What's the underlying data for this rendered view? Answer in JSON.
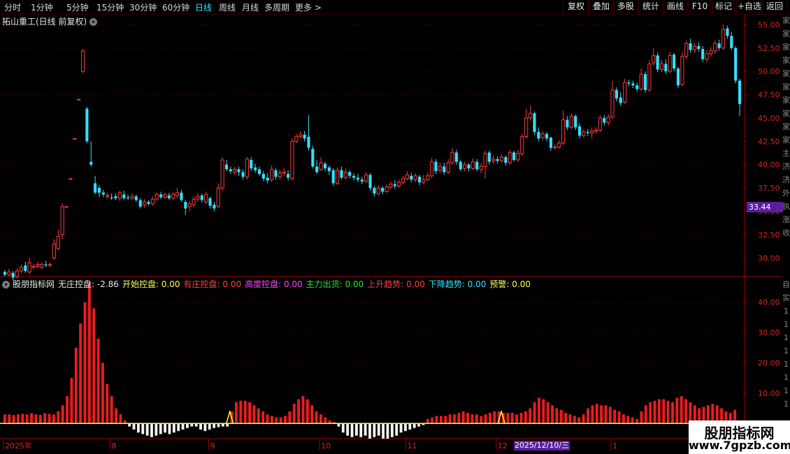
{
  "toolbar": {
    "periods": [
      "分时",
      "1分钟",
      "5分钟",
      "15分钟",
      "30分钟",
      "60分钟",
      "日线",
      "周线",
      "月线",
      "多周期",
      "更多 >"
    ],
    "active_period": "日线",
    "right_buttons": [
      "复权",
      "叠加",
      "多股",
      "统计",
      "画线",
      "F10",
      "标记",
      "+自选",
      "返回"
    ]
  },
  "stock_title": "拓山重工(日线 前复权)",
  "indicator": {
    "name": "股朋指标网",
    "legend": [
      {
        "label": "无庄控盘: -2.86",
        "color": "#e8e8e8"
      },
      {
        "label": "开始控盘: 0.00",
        "color": "#ffff55"
      },
      {
        "label": "有庄控盘: 0.00",
        "color": "#ff4040"
      },
      {
        "label": "高度控盘: 0.00",
        "color": "#ff44ff"
      },
      {
        "label": "主力出货: 0.00",
        "color": "#33dd33"
      },
      {
        "label": "上升趋势: 0.00",
        "color": "#ff4040"
      },
      {
        "label": "下降趋势: 0.00",
        "color": "#33e0ff"
      },
      {
        "label": "预警: 0.00",
        "color": "#ffff55"
      }
    ]
  },
  "price_axis": {
    "ticks": [
      "55.00",
      "52.50",
      "50.00",
      "47.50",
      "45.00",
      "42.50",
      "40.00",
      "37.50",
      "35.00",
      "32.50",
      "30.00"
    ],
    "current_price": "33.44"
  },
  "indicator_axis": {
    "ticks": [
      "40.00",
      "30.00",
      "20.00",
      "10.00"
    ]
  },
  "date_axis": {
    "labels": [
      "2025年",
      "8",
      "9",
      "10",
      "11",
      "12",
      "1"
    ],
    "cursor_date": "2025/12/10/三"
  },
  "side_strip": {
    "top": [
      "家",
      "家",
      "家",
      "家",
      "家",
      "家",
      "家",
      "家",
      "家",
      "家",
      "主",
      "济",
      "济",
      "外",
      "执",
      "涨",
      "收"
    ],
    "bottom": [
      "自",
      "实",
      "1",
      "1",
      "1",
      "1",
      "1",
      "1",
      "1",
      "1"
    ]
  },
  "watermark": {
    "title": "股朋指标网",
    "url": "www.7gpzb.com"
  },
  "colors": {
    "up": "#ff3b3b",
    "down": "#33e0ff",
    "grid": "#5a0000",
    "axis_text": "#e02020"
  },
  "chart_data": [
    {
      "type": "candlestick",
      "title": "拓山重工(日线 前复权)",
      "ylim": [
        28,
        56
      ],
      "candles": [
        [
          28.5,
          28.2,
          28.7,
          28.0
        ],
        [
          28.2,
          28.5,
          28.8,
          28.0
        ],
        [
          28.4,
          27.9,
          28.6,
          27.6
        ],
        [
          28.0,
          28.6,
          28.9,
          27.8
        ],
        [
          28.6,
          29.0,
          29.3,
          28.4
        ],
        [
          29.2,
          28.6,
          29.6,
          28.4
        ],
        [
          28.5,
          29.5,
          30.0,
          28.3
        ],
        [
          29.0,
          29.1,
          29.4,
          28.8
        ],
        [
          29.1,
          29.3,
          29.6,
          28.9
        ],
        [
          29.0,
          29.3,
          29.5,
          28.8
        ],
        [
          29.3,
          29.2,
          29.7,
          29.0
        ],
        [
          29.2,
          29.3,
          29.5,
          29.0
        ],
        [
          30.0,
          31.5,
          32.0,
          29.8
        ],
        [
          31.0,
          32.3,
          33.0,
          30.8
        ],
        [
          32.5,
          35.5,
          35.8,
          32.0
        ],
        [
          35.5,
          35.5,
          35.5,
          35.5
        ],
        [
          38.5,
          38.5,
          38.5,
          38.5
        ],
        [
          42.8,
          42.8,
          42.8,
          42.8
        ],
        [
          47.0,
          47.0,
          47.0,
          47.0
        ],
        [
          50.0,
          52.2,
          52.4,
          49.8
        ],
        [
          46.0,
          42.5,
          46.2,
          42.3
        ],
        [
          40.3,
          40.0,
          42.5,
          39.8
        ],
        [
          38.0,
          37.0,
          38.8,
          36.8
        ],
        [
          37.5,
          37.0,
          37.8,
          36.5
        ],
        [
          37.0,
          36.8,
          37.3,
          36.5
        ],
        [
          36.6,
          36.7,
          37.0,
          36.3
        ],
        [
          36.5,
          36.4,
          36.9,
          36.2
        ],
        [
          36.6,
          36.4,
          36.9,
          36.2
        ],
        [
          36.4,
          37.0,
          37.2,
          36.1
        ],
        [
          36.8,
          36.4,
          37.2,
          36.2
        ],
        [
          36.5,
          36.4,
          36.8,
          36.2
        ],
        [
          36.4,
          36.6,
          36.9,
          36.2
        ],
        [
          36.6,
          36.2,
          36.8,
          36.0
        ],
        [
          36.2,
          35.5,
          36.4,
          35.3
        ],
        [
          35.7,
          36.0,
          36.3,
          35.4
        ],
        [
          36.0,
          35.8,
          36.2,
          35.6
        ],
        [
          35.8,
          36.3,
          36.6,
          35.6
        ],
        [
          36.3,
          36.8,
          37.0,
          36.1
        ],
        [
          36.8,
          36.5,
          37.1,
          36.3
        ],
        [
          36.5,
          36.8,
          37.0,
          36.3
        ],
        [
          36.7,
          36.4,
          37.0,
          36.2
        ],
        [
          36.4,
          36.8,
          37.1,
          36.2
        ],
        [
          36.7,
          37.0,
          37.5,
          36.4
        ],
        [
          37.0,
          36.2,
          37.3,
          36.0
        ],
        [
          36.0,
          35.3,
          36.2,
          34.6
        ],
        [
          35.5,
          35.8,
          36.1,
          35.0
        ],
        [
          35.7,
          36.3,
          36.6,
          35.4
        ],
        [
          36.3,
          36.6,
          36.9,
          36.0
        ],
        [
          36.7,
          36.2,
          36.9,
          35.9
        ],
        [
          36.0,
          36.8,
          37.1,
          35.8
        ],
        [
          36.4,
          35.6,
          36.6,
          35.3
        ],
        [
          35.7,
          35.3,
          36.0,
          35.0
        ],
        [
          35.5,
          37.5,
          38.0,
          35.3
        ],
        [
          37.5,
          40.5,
          40.8,
          37.2
        ],
        [
          40.0,
          39.5,
          40.5,
          39.3
        ],
        [
          39.5,
          39.3,
          39.8,
          39.0
        ],
        [
          39.2,
          39.5,
          39.8,
          38.9
        ],
        [
          39.5,
          39.2,
          39.8,
          38.8
        ],
        [
          39.2,
          38.7,
          39.5,
          38.4
        ],
        [
          38.7,
          40.6,
          40.8,
          38.4
        ],
        [
          40.5,
          39.6,
          40.8,
          39.3
        ],
        [
          39.7,
          39.4,
          40.1,
          39.1
        ],
        [
          39.5,
          39.0,
          39.8,
          38.8
        ],
        [
          39.0,
          38.5,
          39.3,
          38.2
        ],
        [
          38.6,
          38.3,
          39.1,
          38.0
        ],
        [
          38.4,
          39.5,
          39.9,
          38.1
        ],
        [
          39.4,
          38.7,
          39.6,
          38.4
        ],
        [
          38.7,
          39.1,
          39.5,
          38.4
        ],
        [
          39.1,
          39.2,
          39.6,
          38.8
        ],
        [
          39.0,
          38.6,
          39.4,
          38.3
        ],
        [
          38.5,
          42.5,
          42.8,
          38.3
        ],
        [
          42.5,
          43.0,
          43.3,
          42.3
        ],
        [
          43.0,
          43.2,
          43.6,
          42.8
        ],
        [
          43.2,
          42.8,
          43.6,
          42.5
        ],
        [
          43.0,
          41.8,
          45.3,
          41.5
        ],
        [
          41.7,
          39.8,
          42.0,
          39.6
        ],
        [
          39.8,
          39.2,
          40.5,
          39.0
        ],
        [
          39.5,
          40.2,
          40.8,
          39.3
        ],
        [
          40.1,
          39.6,
          40.3,
          39.3
        ],
        [
          39.7,
          39.3,
          39.9,
          38.9
        ],
        [
          39.4,
          38.0,
          39.6,
          37.7
        ],
        [
          38.0,
          39.4,
          39.7,
          37.8
        ],
        [
          39.4,
          38.6,
          39.8,
          38.4
        ],
        [
          38.6,
          39.2,
          39.6,
          38.4
        ],
        [
          39.2,
          38.8,
          39.4,
          38.5
        ],
        [
          38.8,
          38.6,
          39.1,
          38.3
        ],
        [
          38.6,
          38.4,
          39.0,
          38.1
        ],
        [
          38.4,
          38.2,
          38.7,
          37.9
        ],
        [
          38.2,
          38.9,
          39.2,
          38.0
        ],
        [
          38.9,
          37.5,
          39.1,
          37.2
        ],
        [
          37.5,
          36.9,
          37.7,
          36.6
        ],
        [
          36.9,
          37.5,
          37.8,
          36.7
        ],
        [
          37.5,
          37.1,
          37.7,
          36.8
        ],
        [
          37.1,
          37.6,
          37.9,
          37.0
        ],
        [
          37.6,
          37.9,
          38.2,
          37.4
        ],
        [
          37.9,
          37.7,
          38.3,
          37.4
        ],
        [
          37.7,
          38.1,
          38.4,
          37.5
        ],
        [
          38.1,
          38.5,
          38.8,
          37.9
        ],
        [
          38.5,
          38.9,
          39.3,
          38.3
        ],
        [
          38.8,
          38.4,
          39.1,
          38.1
        ],
        [
          38.4,
          38.8,
          39.1,
          38.1
        ],
        [
          38.7,
          38.1,
          38.9,
          37.8
        ],
        [
          38.1,
          38.4,
          38.9,
          37.9
        ],
        [
          38.4,
          38.8,
          39.2,
          38.2
        ],
        [
          38.8,
          40.3,
          40.7,
          38.6
        ],
        [
          40.3,
          39.3,
          40.6,
          39.0
        ],
        [
          39.4,
          39.8,
          40.2,
          39.1
        ],
        [
          39.8,
          39.2,
          40.2,
          38.9
        ],
        [
          39.2,
          40.2,
          40.6,
          39.0
        ],
        [
          40.2,
          41.3,
          41.8,
          40.0
        ],
        [
          41.3,
          40.3,
          41.6,
          40.0
        ],
        [
          40.3,
          39.5,
          40.5,
          39.3
        ],
        [
          39.6,
          40.0,
          40.3,
          39.3
        ],
        [
          40.0,
          39.6,
          40.2,
          39.3
        ],
        [
          39.6,
          40.3,
          40.7,
          39.4
        ],
        [
          40.3,
          39.5,
          40.6,
          39.3
        ],
        [
          39.5,
          39.8,
          40.2,
          39.1
        ],
        [
          39.8,
          41.2,
          41.5,
          38.5
        ],
        [
          41.3,
          40.3,
          41.5,
          40.0
        ],
        [
          40.4,
          40.6,
          41.0,
          40.1
        ],
        [
          40.6,
          40.4,
          40.9,
          40.1
        ],
        [
          40.4,
          40.8,
          41.1,
          40.2
        ],
        [
          40.8,
          40.2,
          41.0,
          39.9
        ],
        [
          40.2,
          41.3,
          41.6,
          40.0
        ],
        [
          41.3,
          40.5,
          41.5,
          40.3
        ],
        [
          40.5,
          41.2,
          41.6,
          40.3
        ],
        [
          41.2,
          43.0,
          43.3,
          40.9
        ],
        [
          43.0,
          45.0,
          46.0,
          42.8
        ],
        [
          45.0,
          45.5,
          46.3,
          44.7
        ],
        [
          45.5,
          43.5,
          45.7,
          43.2
        ],
        [
          43.5,
          42.8,
          44.0,
          42.5
        ],
        [
          42.9,
          43.3,
          43.6,
          42.6
        ],
        [
          43.3,
          42.8,
          43.5,
          42.5
        ],
        [
          42.9,
          41.8,
          43.0,
          41.5
        ],
        [
          41.9,
          41.9,
          42.2,
          41.6
        ],
        [
          41.9,
          42.3,
          42.6,
          41.7
        ],
        [
          42.3,
          44.8,
          45.8,
          42.1
        ],
        [
          44.8,
          44.0,
          45.2,
          43.7
        ],
        [
          44.0,
          45.2,
          45.5,
          43.8
        ],
        [
          45.2,
          44.0,
          45.4,
          43.7
        ],
        [
          44.1,
          43.1,
          44.4,
          42.8
        ],
        [
          43.1,
          43.5,
          43.8,
          42.9
        ],
        [
          43.5,
          43.4,
          43.8,
          43.1
        ],
        [
          43.4,
          43.6,
          44.0,
          42.8
        ],
        [
          43.6,
          43.7,
          44.0,
          43.3
        ],
        [
          43.7,
          45.0,
          45.3,
          43.5
        ],
        [
          45.0,
          44.5,
          45.3,
          44.2
        ],
        [
          44.5,
          45.1,
          45.4,
          44.2
        ],
        [
          45.1,
          48.0,
          49.0,
          44.9
        ],
        [
          48.0,
          47.1,
          48.3,
          46.8
        ],
        [
          47.2,
          46.6,
          47.8,
          46.3
        ],
        [
          46.7,
          48.8,
          49.2,
          46.5
        ],
        [
          48.8,
          48.7,
          49.1,
          48.4
        ],
        [
          48.7,
          48.5,
          49.0,
          48.2
        ],
        [
          48.5,
          48.1,
          48.8,
          47.8
        ],
        [
          48.1,
          49.7,
          50.3,
          47.9
        ],
        [
          49.7,
          48.0,
          50.0,
          47.7
        ],
        [
          48.0,
          50.8,
          51.2,
          47.8
        ],
        [
          50.9,
          51.7,
          52.5,
          50.6
        ],
        [
          51.7,
          50.2,
          52.0,
          49.9
        ],
        [
          50.2,
          50.8,
          51.2,
          49.9
        ],
        [
          50.8,
          50.0,
          51.3,
          49.7
        ],
        [
          50.0,
          51.7,
          52.1,
          49.8
        ],
        [
          51.8,
          50.3,
          52.0,
          50.0
        ],
        [
          50.3,
          48.5,
          50.5,
          48.2
        ],
        [
          48.6,
          51.6,
          52.0,
          48.4
        ],
        [
          51.6,
          53.0,
          53.3,
          51.3
        ],
        [
          53.0,
          52.3,
          53.5,
          52.0
        ],
        [
          52.3,
          52.7,
          53.0,
          52.0
        ],
        [
          52.7,
          52.4,
          53.1,
          52.1
        ],
        [
          52.4,
          51.3,
          52.7,
          51.0
        ],
        [
          51.3,
          51.9,
          52.3,
          51.0
        ],
        [
          51.9,
          52.2,
          52.6,
          51.6
        ],
        [
          52.2,
          53.0,
          53.3,
          51.9
        ],
        [
          53.0,
          52.5,
          53.4,
          52.2
        ],
        [
          52.5,
          54.5,
          55.0,
          52.3
        ],
        [
          54.6,
          53.8,
          54.9,
          53.5
        ],
        [
          53.8,
          52.5,
          54.2,
          52.3
        ],
        [
          52.5,
          49.0,
          52.7,
          48.7
        ],
        [
          49.0,
          46.5,
          49.2,
          45.2
        ]
      ]
    },
    {
      "type": "bar",
      "title": "股朋指标网",
      "ylim": [
        -5,
        48
      ],
      "values": [
        3.0,
        3.0,
        2.8,
        3.0,
        3.2,
        3.0,
        3.4,
        3.0,
        2.8,
        3.4,
        3.2,
        3.0,
        4.0,
        6.0,
        9.0,
        15.0,
        25.0,
        33.0,
        40.0,
        46.5,
        38.0,
        28.0,
        20.0,
        13.0,
        9.0,
        5.0,
        3.0,
        1.0,
        -1.0,
        -2.0,
        -3.0,
        -3.5,
        -4.0,
        -4.5,
        -4.0,
        -3.5,
        -3.0,
        -3.5,
        -3.0,
        -2.5,
        -2.0,
        -1.5,
        -1.0,
        -1.0,
        -2.0,
        -2.5,
        -2.0,
        -1.5,
        -1.2,
        -1.0,
        -1.0,
        4.0,
        7.0,
        7.5,
        7.5,
        7.0,
        6.0,
        5.0,
        4.0,
        3.0,
        2.5,
        2.0,
        2.0,
        2.5,
        4.0,
        6.5,
        8.0,
        9.0,
        8.0,
        6.0,
        4.0,
        3.0,
        2.0,
        1.0,
        0.5,
        -1.0,
        -3.0,
        -4.0,
        -4.5,
        -4.0,
        -4.5,
        -4.0,
        -5.0,
        -4.5,
        -4.0,
        -5.0,
        -5.0,
        -4.5,
        -4.0,
        -3.0,
        -2.5,
        -2.0,
        -1.5,
        -1.0,
        -0.5,
        1.5,
        2.0,
        2.5,
        2.5,
        2.5,
        3.0,
        3.0,
        3.5,
        4.0,
        3.5,
        3.0,
        3.0,
        2.5,
        3.0,
        3.5,
        4.0,
        4.0,
        3.5,
        3.5,
        3.5,
        3.0,
        3.5,
        4.0,
        5.0,
        7.0,
        8.5,
        8.0,
        7.0,
        6.0,
        5.0,
        4.5,
        3.5,
        3.0,
        2.5,
        2.0,
        3.0,
        5.0,
        6.0,
        6.5,
        6.0,
        6.0,
        5.5,
        4.5,
        4.0,
        3.0,
        2.5,
        2.0,
        1.5,
        4.0,
        6.0,
        7.0,
        7.5,
        8.0,
        8.0,
        7.5,
        7.0,
        8.5,
        9.0,
        8.0,
        7.0,
        6.0,
        5.0,
        5.5,
        6.0,
        6.5,
        6.0,
        5.0,
        4.0,
        3.5,
        4.5,
        1.0
      ]
    }
  ]
}
